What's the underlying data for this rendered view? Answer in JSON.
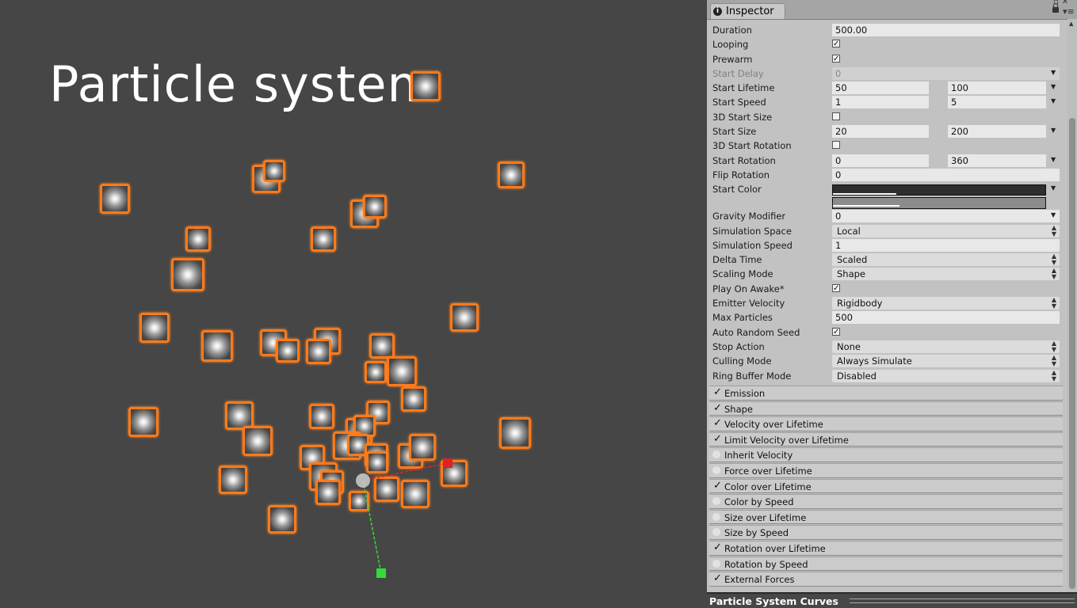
{
  "scene": {
    "title": "Particle system",
    "particle_border_color": "#ff7a1a"
  },
  "inspector": {
    "tab_label": "Inspector",
    "tab_icon": "info-icon",
    "properties": [
      {
        "label": "Duration",
        "value": "500.00"
      },
      {
        "label": "Looping",
        "checked": true
      },
      {
        "label": "Prewarm",
        "checked": true
      },
      {
        "label": "Start Delay",
        "value": "0"
      },
      {
        "label": "Start Lifetime",
        "min": "50",
        "max": "100"
      },
      {
        "label": "Start Speed",
        "min": "1",
        "max": "5"
      },
      {
        "label": "3D Start Size",
        "checked": false
      },
      {
        "label": "Start Size",
        "min": "20",
        "max": "200"
      },
      {
        "label": "3D Start Rotation",
        "checked": false
      },
      {
        "label": "Start Rotation",
        "min": "0",
        "max": "360"
      },
      {
        "label": "Flip Rotation",
        "value": "0"
      },
      {
        "label": "Start Color"
      },
      {
        "label": "Gravity Modifier",
        "value": "0"
      },
      {
        "label": "Simulation Space",
        "value": "Local"
      },
      {
        "label": "Simulation Speed",
        "value": "1"
      },
      {
        "label": "Delta Time",
        "value": "Scaled"
      },
      {
        "label": "Scaling Mode",
        "value": "Shape"
      },
      {
        "label": "Play On Awake*",
        "checked": true
      },
      {
        "label": "Emitter Velocity",
        "value": "Rigidbody"
      },
      {
        "label": "Max Particles",
        "value": "500"
      },
      {
        "label": "Auto Random Seed",
        "checked": true
      },
      {
        "label": "Stop Action",
        "value": "None"
      },
      {
        "label": "Culling Mode",
        "value": "Always Simulate"
      },
      {
        "label": "Ring Buffer Mode",
        "value": "Disabled"
      }
    ],
    "modules": [
      {
        "label": "Emission",
        "enabled": true
      },
      {
        "label": "Shape",
        "enabled": true
      },
      {
        "label": "Velocity over Lifetime",
        "enabled": true
      },
      {
        "label": "Limit Velocity over Lifetime",
        "enabled": true
      },
      {
        "label": "Inherit Velocity",
        "enabled": false
      },
      {
        "label": "Force over Lifetime",
        "enabled": false
      },
      {
        "label": "Color over Lifetime",
        "enabled": true
      },
      {
        "label": "Color by Speed",
        "enabled": false
      },
      {
        "label": "Size over Lifetime",
        "enabled": false
      },
      {
        "label": "Size by Speed",
        "enabled": false
      },
      {
        "label": "Rotation over Lifetime",
        "enabled": true
      },
      {
        "label": "Rotation by Speed",
        "enabled": false
      },
      {
        "label": "External Forces",
        "enabled": true
      }
    ]
  },
  "bottom_panel": {
    "title": "Particle System Curves"
  },
  "gizmo": {
    "x_axis_color": "#dd2222",
    "y_axis_color": "#33dd33"
  }
}
